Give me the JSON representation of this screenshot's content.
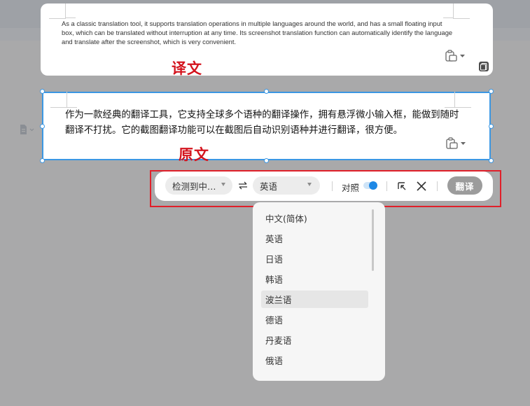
{
  "result_card": {
    "text": "As a classic translation tool, it supports translation operations in multiple languages around the world, and has a small floating input box, which can be translated without interruption at any time. Its screenshot translation function can automatically identify the language and translate after the screenshot, which is very convenient."
  },
  "labels": {
    "translation": "译文",
    "original": "原文"
  },
  "source_card": {
    "text": "作为一款经典的翻译工具，它支持全球多个语种的翻译操作，拥有悬浮微小输入框，能做到随时翻译不打扰。它的截图翻译功能可以在截图后自动识别语种并进行翻译，很方便。"
  },
  "toolbar": {
    "source_lang": "检测到中…",
    "target_lang": "英语",
    "contrast_label": "对照",
    "contrast_on": true,
    "translate_label": "翻译"
  },
  "dropdown": {
    "options": [
      "中文(简体)",
      "英语",
      "日语",
      "韩语",
      "波兰语",
      "德语",
      "丹麦语",
      "俄语"
    ],
    "hovered": "波兰语"
  },
  "colors": {
    "accent": "#1e88e5",
    "selection_border": "#3b97e3",
    "annotation_red": "#d4141e"
  }
}
